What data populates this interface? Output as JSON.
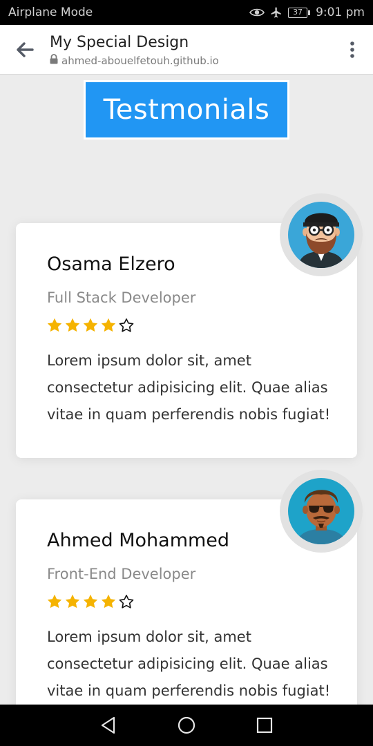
{
  "status_bar": {
    "mode": "Airplane Mode",
    "battery": "37",
    "time": "9:01 pm"
  },
  "browser": {
    "title": "My Special Design",
    "url": "ahmed-abouelfetouh.github.io"
  },
  "section": {
    "heading": "Testmonials"
  },
  "testimonials": [
    {
      "name": "Osama Elzero",
      "role": "Full Stack Developer",
      "rating": 4,
      "max_rating": 5,
      "text": "Lorem ipsum dolor sit, amet consectetur adipisicing elit. Quae alias vitae in quam perferendis nobis fugiat!"
    },
    {
      "name": "Ahmed Mohammed",
      "role": "Front-End Developer",
      "rating": 4,
      "max_rating": 5,
      "text": "Lorem ipsum dolor sit, amet consectetur adipisicing elit. Quae alias vitae in quam perferendis nobis fugiat!"
    }
  ],
  "colors": {
    "accent": "#2196f3",
    "star": "#f5b301",
    "background": "#ececec"
  },
  "icons": {
    "back": "arrow-left-icon",
    "lock": "lock-icon",
    "menu": "more-vert-icon",
    "nav_back": "triangle-back-icon",
    "nav_home": "circle-home-icon",
    "nav_recents": "square-recents-icon"
  }
}
